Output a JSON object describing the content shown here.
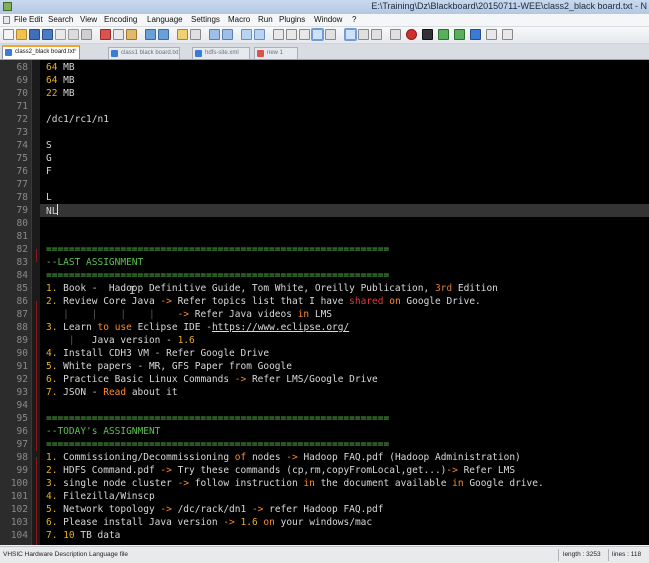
{
  "window": {
    "title": "E:\\Training\\Dz\\Blackboard\\20150711-WEE\\class2_black board.txt - N"
  },
  "menubar": {
    "items": [
      "File",
      "Edit",
      "Search",
      "View",
      "Encoding",
      "Language",
      "Settings",
      "Macro",
      "Run",
      "Plugins",
      "Window",
      "?"
    ]
  },
  "tabs": [
    {
      "label": "class2_black board.txt",
      "active": true
    },
    {
      "label": "class1 black board.txt",
      "active": false
    },
    {
      "label": "hdfs-site.xml",
      "active": false
    },
    {
      "label": "new 1",
      "active": false
    }
  ],
  "editor": {
    "lines": [
      {
        "n": "68",
        "segs": [
          [
            "m",
            "64"
          ],
          [
            "t",
            " MB"
          ]
        ]
      },
      {
        "n": "69",
        "segs": [
          [
            "m",
            "64"
          ],
          [
            "t",
            " MB"
          ]
        ]
      },
      {
        "n": "70",
        "segs": [
          [
            "m",
            "22"
          ],
          [
            "t",
            " MB"
          ]
        ]
      },
      {
        "n": "71",
        "segs": []
      },
      {
        "n": "72",
        "segs": [
          [
            "t",
            "/dc1/rc1/n1"
          ]
        ]
      },
      {
        "n": "73",
        "segs": []
      },
      {
        "n": "74",
        "segs": [
          [
            "t",
            "S"
          ]
        ]
      },
      {
        "n": "75",
        "segs": [
          [
            "t",
            "G"
          ]
        ]
      },
      {
        "n": "76",
        "segs": [
          [
            "t",
            "F"
          ]
        ]
      },
      {
        "n": "77",
        "segs": []
      },
      {
        "n": "78",
        "segs": [
          [
            "t",
            "L"
          ]
        ]
      },
      {
        "n": "79",
        "segs": [
          [
            "t",
            "NL"
          ]
        ],
        "current": true
      },
      {
        "n": "80",
        "segs": []
      },
      {
        "n": "81",
        "segs": []
      },
      {
        "n": "82",
        "segs": [
          [
            "g",
            "============================================================"
          ]
        ]
      },
      {
        "n": "83",
        "segs": [
          [
            "g",
            "--LAST ASSIGNMENT"
          ]
        ]
      },
      {
        "n": "84",
        "segs": [
          [
            "g",
            "============================================================"
          ]
        ]
      },
      {
        "n": "85",
        "segs": [
          [
            "m",
            "1."
          ],
          [
            "t",
            " Book -  Hadoop Definitive Guide, Tom White, Oreilly Publication, "
          ],
          [
            "n",
            "3rd"
          ],
          [
            "t",
            " Edition"
          ]
        ]
      },
      {
        "n": "86",
        "segs": [
          [
            "m",
            "2."
          ],
          [
            "t",
            " Review Core Java "
          ],
          [
            "k",
            "->"
          ],
          [
            "t",
            " Refer topics list that I have "
          ],
          [
            "r",
            "shared"
          ],
          [
            "t",
            " "
          ],
          [
            "k",
            "on"
          ],
          [
            "t",
            " Google Drive."
          ]
        ]
      },
      {
        "n": "87",
        "segs": [
          [
            "sel1",
            "   |    |    |    |    "
          ],
          [
            "k",
            "->"
          ],
          [
            "t",
            " Refer Java videos "
          ],
          [
            "k",
            "in"
          ],
          [
            "t",
            " LMS"
          ]
        ]
      },
      {
        "n": "88",
        "segs": [
          [
            "m",
            "3."
          ],
          [
            "t",
            " Learn "
          ],
          [
            "k",
            "to"
          ],
          [
            "t",
            " "
          ],
          [
            "k",
            "use"
          ],
          [
            "t",
            " Eclipse IDE -"
          ],
          [
            "u",
            "https://www.eclipse.org/"
          ]
        ]
      },
      {
        "n": "89",
        "segs": [
          [
            "sel1",
            "    |   "
          ],
          [
            "t",
            "Java version - "
          ],
          [
            "m",
            "1.6"
          ]
        ]
      },
      {
        "n": "90",
        "segs": [
          [
            "m",
            "4."
          ],
          [
            "t",
            " Install CDH3 VM - Refer Google Drive"
          ]
        ]
      },
      {
        "n": "91",
        "segs": [
          [
            "m",
            "5."
          ],
          [
            "t",
            " White papers - MR, GFS Paper from Google"
          ]
        ]
      },
      {
        "n": "92",
        "segs": [
          [
            "m",
            "6."
          ],
          [
            "t",
            " Practice Basic Linux Commands "
          ],
          [
            "k",
            "->"
          ],
          [
            "t",
            " Refer LMS/Google Drive"
          ]
        ]
      },
      {
        "n": "93",
        "segs": [
          [
            "m",
            "7."
          ],
          [
            "t",
            " JSON - "
          ],
          [
            "k",
            "Read"
          ],
          [
            "t",
            " about it"
          ]
        ]
      },
      {
        "n": "94",
        "segs": []
      },
      {
        "n": "95",
        "segs": [
          [
            "g",
            "============================================================"
          ]
        ]
      },
      {
        "n": "96",
        "segs": [
          [
            "g",
            "--TODAY's ASSIGNMENT"
          ]
        ]
      },
      {
        "n": "97",
        "segs": [
          [
            "g",
            "============================================================"
          ]
        ]
      },
      {
        "n": "98",
        "segs": [
          [
            "m",
            "1."
          ],
          [
            "t",
            " Commissioning/Decommissioning "
          ],
          [
            "k",
            "of"
          ],
          [
            "t",
            " nodes "
          ],
          [
            "k",
            "->"
          ],
          [
            "t",
            " Hadoop FAQ.pdf (Hadoop Administration)"
          ]
        ]
      },
      {
        "n": "99",
        "segs": [
          [
            "m",
            "2."
          ],
          [
            "t",
            " HDFS Command.pdf "
          ],
          [
            "k",
            "->"
          ],
          [
            "t",
            " Try these commands (cp,rm,copyFromLocal,get...)"
          ],
          [
            "k",
            "->"
          ],
          [
            "t",
            " Refer LMS"
          ]
        ]
      },
      {
        "n": "100",
        "segs": [
          [
            "m",
            "3."
          ],
          [
            "t",
            " single node cluster "
          ],
          [
            "k",
            "->"
          ],
          [
            "t",
            " follow instruction "
          ],
          [
            "k",
            "in"
          ],
          [
            "t",
            " the document available "
          ],
          [
            "k",
            "in"
          ],
          [
            "t",
            " Google drive."
          ]
        ]
      },
      {
        "n": "101",
        "segs": [
          [
            "m",
            "4."
          ],
          [
            "t",
            " Filezilla/Winscp"
          ]
        ]
      },
      {
        "n": "102",
        "segs": [
          [
            "m",
            "5."
          ],
          [
            "t",
            " Network topology "
          ],
          [
            "k",
            "->"
          ],
          [
            "t",
            " /dc/rack/dn1 "
          ],
          [
            "k",
            "->"
          ],
          [
            "t",
            " refer Hadoop FAQ.pdf"
          ]
        ]
      },
      {
        "n": "103",
        "segs": [
          [
            "m",
            "6."
          ],
          [
            "t",
            " Please install Java version "
          ],
          [
            "k",
            "->"
          ],
          [
            "t",
            " "
          ],
          [
            "m",
            "1.6"
          ],
          [
            "t",
            " "
          ],
          [
            "k",
            "on"
          ],
          [
            "t",
            " your windows/mac"
          ]
        ]
      },
      {
        "n": "104",
        "segs": [
          [
            "m",
            "7."
          ],
          [
            "t",
            " "
          ],
          [
            "m",
            "10"
          ],
          [
            "t",
            " TB data"
          ]
        ]
      }
    ]
  },
  "statusbar": {
    "language": "VHSIC Hardware Description Language file",
    "length": "length : 3253",
    "lines": "lines : 118"
  },
  "colors": {
    "background": "#000000",
    "text": "#d8d8d8",
    "number": "#e8b01c",
    "keyword": "#ff8a2a",
    "comment": "#5cc24e",
    "string": "#e53935"
  }
}
